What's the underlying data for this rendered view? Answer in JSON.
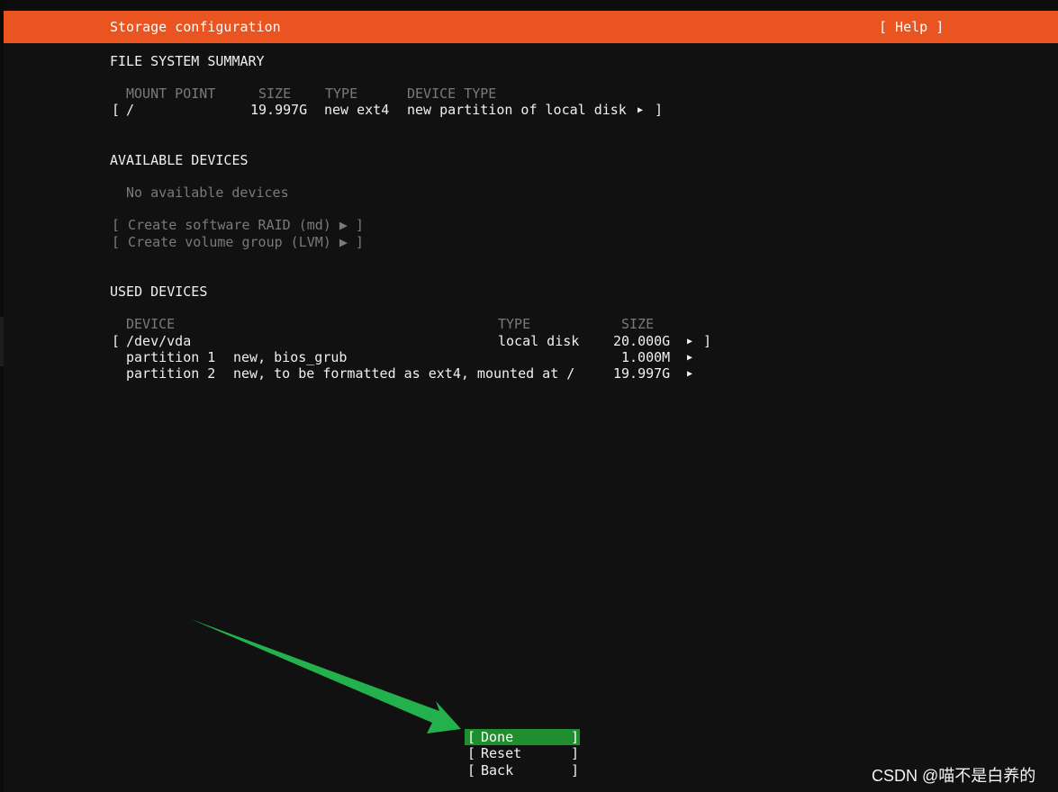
{
  "header": {
    "title": "Storage configuration",
    "help": "[ Help ]"
  },
  "fs_summary": {
    "heading": "FILE SYSTEM SUMMARY",
    "columns": {
      "mount_point": "MOUNT POINT",
      "size": "SIZE",
      "type": "TYPE",
      "device_type": "DEVICE TYPE"
    },
    "row": {
      "open_bracket": "[",
      "mount": "/",
      "size": "19.997G",
      "type": "new ext4",
      "device_type": "new partition of local disk",
      "arrow": "▶",
      "close_bracket": "]"
    }
  },
  "available": {
    "heading": "AVAILABLE DEVICES",
    "empty_text": "No available devices",
    "create_raid": "[ Create software RAID (md) ▶ ]",
    "create_lvm": "[ Create volume group (LVM) ▶ ]"
  },
  "used": {
    "heading": "USED DEVICES",
    "columns": {
      "device": "DEVICE",
      "type": "TYPE",
      "size": "SIZE"
    },
    "disk": {
      "open_bracket": "[",
      "device": "/dev/vda",
      "type": "local disk",
      "size": "20.000G",
      "arrow": "▶",
      "close_bracket": "]"
    },
    "partitions": [
      {
        "name": "partition 1",
        "desc": "new, bios_grub",
        "size": "1.000M",
        "arrow": "▶"
      },
      {
        "name": "partition 2",
        "desc": "new, to be formatted as ext4, mounted at /",
        "size": "19.997G",
        "arrow": "▶"
      }
    ]
  },
  "buttons": {
    "open_bracket": "[",
    "close_bracket": "]",
    "done": "Done",
    "reset": "Reset",
    "back": "Back"
  },
  "watermark": "CSDN @喵不是白养的",
  "colors": {
    "header_bg": "#e95420",
    "done_bg": "#1e8e2e",
    "annotation_arrow": "#22b14c",
    "background": "#111111"
  }
}
